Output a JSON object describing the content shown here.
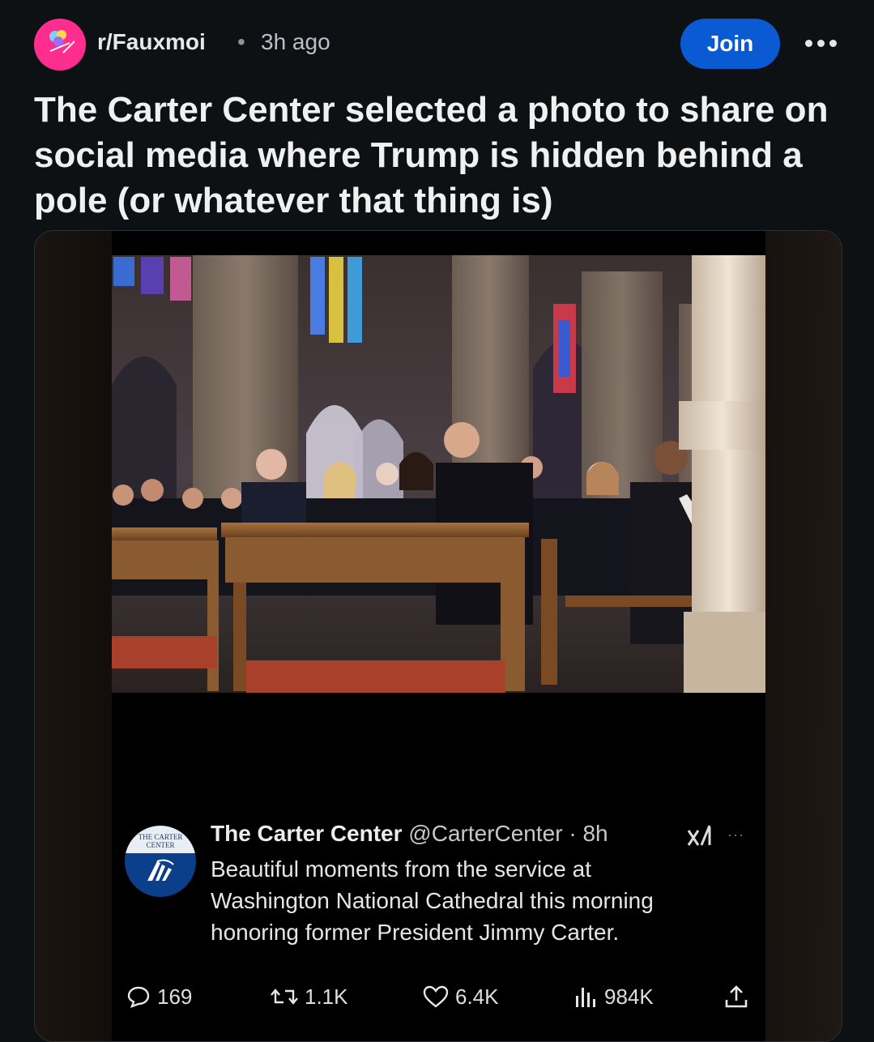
{
  "post": {
    "subreddit": "r/Fauxmoi",
    "separator": "•",
    "time_ago": "3h ago",
    "join_label": "Join",
    "title": "The Carter Center selected a photo to share on social media where Trump is hidden behind a pole (or whatever that thing is)"
  },
  "tweet": {
    "display_name": "The Carter Center",
    "handle_time": "@CarterCenter · 8h",
    "avatar_text": "THE CARTER CENTER",
    "text": "Beautiful moments from the service at Washington National Cathedral this morning honoring former President Jimmy Carter.",
    "more": "···",
    "stats": {
      "replies": "169",
      "reposts": "1.1K",
      "likes": "6.4K",
      "views": "984K"
    }
  },
  "icons": {
    "more": "more-horizontal-icon",
    "reply": "speech-bubble-icon",
    "repost": "repost-arrows-icon",
    "like": "heart-icon",
    "views": "bar-chart-icon",
    "share": "share-upload-icon",
    "grok": "xai-grok-icon"
  },
  "colors": {
    "background": "#0e1113",
    "join_button": "#0a5bd3",
    "avatar_bg": "#ff2d8e",
    "tweet_avatar_bg": "#0b3f8a"
  }
}
